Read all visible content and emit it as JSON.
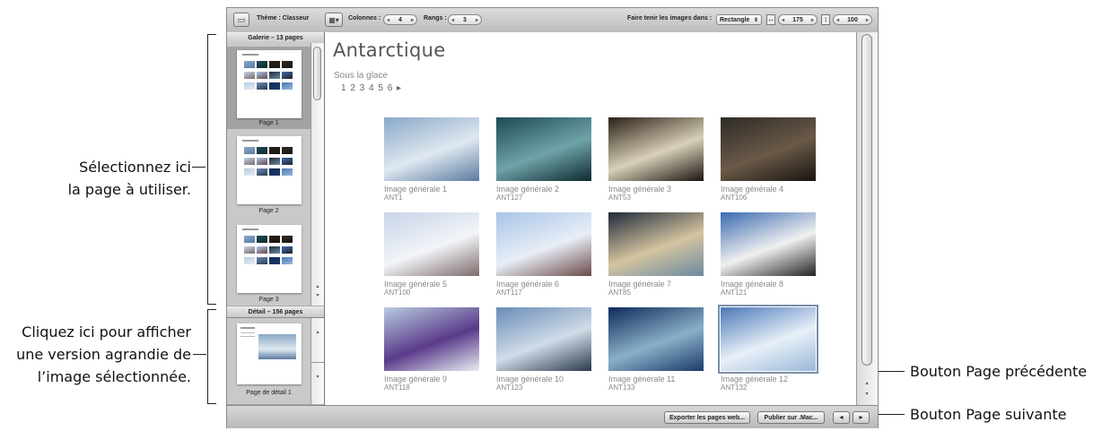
{
  "annotations": {
    "select_page": [
      "Sélectionnez ici",
      "la page à utiliser."
    ],
    "click_detail": [
      "Cliquez ici pour afficher",
      "une version agrandie de",
      "l’image sélectionnée."
    ],
    "prev_button": "Bouton Page précédente",
    "next_button": "Bouton Page suivante"
  },
  "toolbar": {
    "theme_label": "Thème : Classeur",
    "columns_label": "Colonnes :",
    "columns_value": "4",
    "rows_label": "Rangs :",
    "rows_value": "3",
    "fit_label": "Faire tenir les images dans :",
    "fit_value": "Rectangle",
    "width_value": "175",
    "height_value": "100"
  },
  "sidebar": {
    "gallery_header": "Galerie – 13 pages",
    "pages": [
      {
        "label": "Page 1"
      },
      {
        "label": "Page 2"
      },
      {
        "label": "Page 3"
      }
    ],
    "detail_header": "Détail – 156 pages",
    "detail_label": "Page de détail 1"
  },
  "main": {
    "title": "Antarctique",
    "subtitle": "Sous la glace",
    "pager": "1 2 3 4 5 6 ▸",
    "images": [
      {
        "caption": "Image générale  1",
        "code": "ANT1",
        "colors": [
          "#8aa8c8",
          "#dfe8f0",
          "#5a7aa0"
        ]
      },
      {
        "caption": "Image générale  2",
        "code": "ANT127",
        "colors": [
          "#1d4a52",
          "#6fa3a8",
          "#0e2a30"
        ]
      },
      {
        "caption": "Image générale  3",
        "code": "ANT53",
        "colors": [
          "#2a2016",
          "#d8d0b8",
          "#1a1410"
        ]
      },
      {
        "caption": "Image générale  4",
        "code": "ANT106",
        "colors": [
          "#2e2a26",
          "#6a5a48",
          "#18140f"
        ]
      },
      {
        "caption": "Image générale  5",
        "code": "ANT100",
        "colors": [
          "#c8d4e8",
          "#f2f4f8",
          "#7c6a6a"
        ]
      },
      {
        "caption": "Image générale  6",
        "code": "ANT117",
        "colors": [
          "#a8c4e8",
          "#e8eef6",
          "#6a4a4a"
        ]
      },
      {
        "caption": "Image générale  7",
        "code": "ANT85",
        "colors": [
          "#202a3a",
          "#d4c4a0",
          "#6a8aa0"
        ]
      },
      {
        "caption": "Image générale  8",
        "code": "ANT121",
        "colors": [
          "#3a6ab0",
          "#f0f0f0",
          "#222222"
        ]
      },
      {
        "caption": "Image générale  9",
        "code": "ANT118",
        "colors": [
          "#b8cce0",
          "#5a3a8a",
          "#e8eef4"
        ]
      },
      {
        "caption": "Image générale  10",
        "code": "ANT123",
        "colors": [
          "#6a8cb8",
          "#d0dce8",
          "#2a3a4a"
        ]
      },
      {
        "caption": "Image générale  11",
        "code": "ANT133",
        "colors": [
          "#0e2a5a",
          "#8ab0c8",
          "#1a3a6a"
        ]
      },
      {
        "caption": "Image générale  12",
        "code": "ANT132",
        "colors": [
          "#4a78b8",
          "#e8f0f8",
          "#9ab8d8"
        ]
      }
    ]
  },
  "bottom": {
    "export_label": "Exporter les pages web...",
    "publish_label": "Publier sur .Mac...",
    "prev_glyph": "◂",
    "next_glyph": "▸"
  }
}
